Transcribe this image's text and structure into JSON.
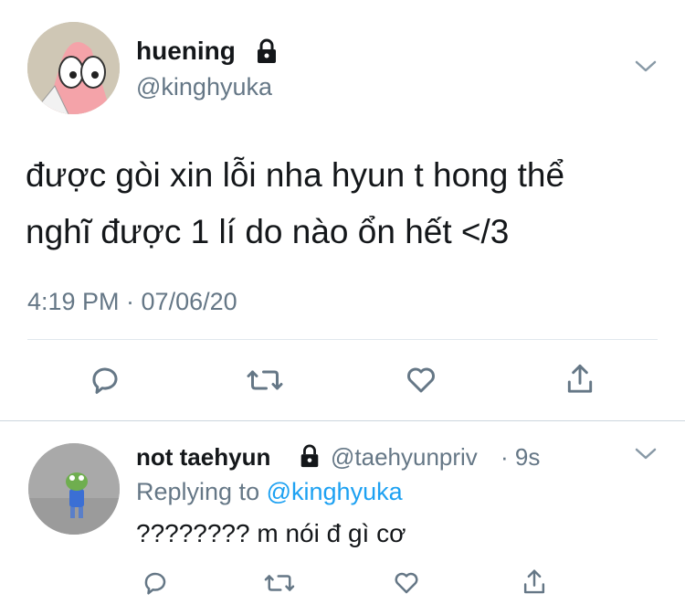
{
  "main_tweet": {
    "display_name": "huening",
    "handle": "@kinghyuka",
    "text_line1": "được gòi xin lỗi nha hyun t hong thể",
    "text_line2": "nghĩ được 1 lí do nào ổn hết </3",
    "timestamp": "4:19 PM · 07/06/20",
    "avatar_icon": "patrick-star-avatar",
    "protected_icon": "lock-icon"
  },
  "reply": {
    "display_name": "not taehyun",
    "handle": "@taehyunpriv",
    "time": "· 9s",
    "replying_prefix": "Replying to",
    "replying_to": "@kinghyuka",
    "text": "???????? m nói đ gì cơ",
    "avatar_icon": "frog-avatar",
    "protected_icon": "lock-icon"
  },
  "actions": [
    "reply-icon",
    "retweet-icon",
    "like-icon",
    "share-icon"
  ],
  "colors": {
    "accent": "#1da1f2",
    "secondary_text": "#657786",
    "divider": "#e1e8ed"
  }
}
